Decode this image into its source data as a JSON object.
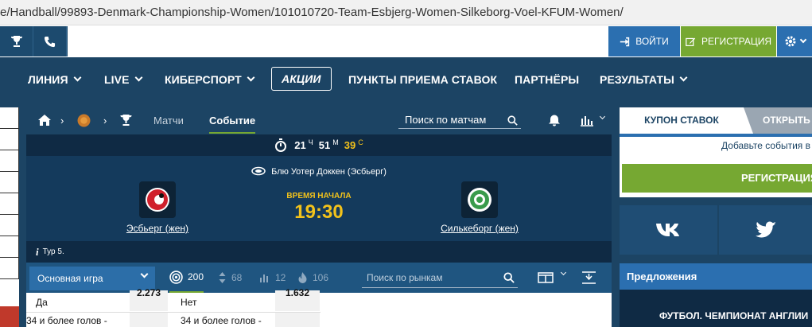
{
  "browser": {
    "url": "e/Handball/99893-Denmark-Championship-Women/101010720-Team-Esbjerg-Women-Silkeborg-Voel-KFUM-Women/"
  },
  "topbar": {
    "login": "ВОЙТИ",
    "register": "РЕГИСТРАЦИЯ"
  },
  "nav": {
    "items": [
      {
        "label": "ЛИНИЯ"
      },
      {
        "label": "LIVE"
      },
      {
        "label": "КИБЕРСПОРТ"
      },
      {
        "label": "АКЦИИ"
      },
      {
        "label": "ПУНКТЫ ПРИЕМА СТАВОК"
      },
      {
        "label": "ПАРТНЁРЫ"
      },
      {
        "label": "РЕЗУЛЬТАТЫ"
      }
    ]
  },
  "breadcrumb": {
    "tab_matches": "Матчи",
    "tab_event": "Событие",
    "search_placeholder": "Поиск по матчам"
  },
  "timer": {
    "hours": "21",
    "h_unit": "Ч",
    "minutes": "51",
    "m_unit": "М",
    "seconds": "39",
    "s_unit": "С"
  },
  "event": {
    "venue": "Блю Уотер Доккен (Эсбьерг)",
    "home": "Эсбьерг (жен)",
    "away": "Силькеборг (жен)",
    "start_label": "ВРЕМЯ НАЧАЛА",
    "start_time": "19:30",
    "tour": "Тур 5."
  },
  "markets": {
    "group": "Основная игра",
    "counts": {
      "all": "200",
      "sort": "68",
      "stats": "12",
      "hot": "106"
    },
    "search_placeholder": "Поиск по рынкам"
  },
  "table": {
    "row1": {
      "left_label": "Да",
      "left_odd": "2.273",
      "right_label": "Нет",
      "right_odd": "1.632"
    },
    "row2": {
      "left_label": "34 и более голов -",
      "right_label": "34 и более голов -"
    }
  },
  "coupon": {
    "tab1": "КУПОН СТАВОК",
    "tab2": "ОТКРЫТЬ",
    "hint": "Добавьте события в",
    "register": "РЕГИСТРАЦИЯ"
  },
  "sidebar": {
    "offers": "Предложения",
    "promo": "ФУТБОЛ. ЧЕМПИОНАТ АНГЛИИ"
  },
  "colors": {
    "nav": "#1c4464",
    "accent_green": "#76a832",
    "accent_blue": "#2b6fb0",
    "highlight": "#f2c21b"
  }
}
